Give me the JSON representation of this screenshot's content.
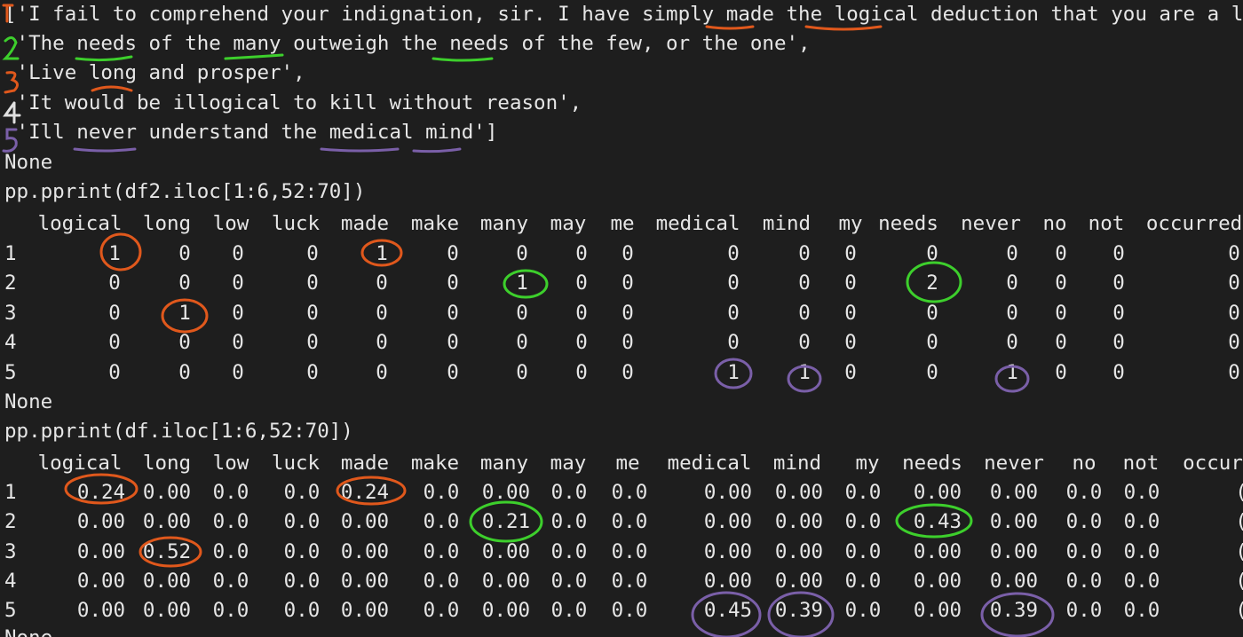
{
  "colors": {
    "background": "#1e1e1e",
    "text": "#e6e6e6",
    "orange": "#e0581c",
    "green": "#3dcf2c",
    "purple": "#7a5fa8"
  },
  "quotes": [
    "['I fail to comprehend your indignation, sir. I have simply made the logical deduction that you are a liar",
    " 'The needs of the many outweigh the needs of the few, or the one',",
    " 'Live long and prosper',",
    " 'It would be illogical to kill without reason',",
    " 'Ill never understand the medical mind']"
  ],
  "margin_numbers": [
    "1",
    "2",
    "3",
    "4",
    "5"
  ],
  "none_1": "None",
  "cmd_1": "pp.pprint(df2.iloc[1:6,52:70])",
  "table1": {
    "headers": [
      "logical",
      "long",
      "low",
      "luck",
      "made",
      "make",
      "many",
      "may",
      "me",
      "medical",
      "mind",
      "my",
      "needs",
      "never",
      "no",
      "not",
      "occurred"
    ],
    "rows": [
      {
        "index": "1",
        "values": [
          "1",
          "0",
          "0",
          "0",
          "1",
          "0",
          "0",
          "0",
          "0",
          "0",
          "0",
          "0",
          "0",
          "0",
          "0",
          "0",
          "0"
        ]
      },
      {
        "index": "2",
        "values": [
          "0",
          "0",
          "0",
          "0",
          "0",
          "0",
          "1",
          "0",
          "0",
          "0",
          "0",
          "0",
          "2",
          "0",
          "0",
          "0",
          "0"
        ]
      },
      {
        "index": "3",
        "values": [
          "0",
          "1",
          "0",
          "0",
          "0",
          "0",
          "0",
          "0",
          "0",
          "0",
          "0",
          "0",
          "0",
          "0",
          "0",
          "0",
          "0"
        ]
      },
      {
        "index": "4",
        "values": [
          "0",
          "0",
          "0",
          "0",
          "0",
          "0",
          "0",
          "0",
          "0",
          "0",
          "0",
          "0",
          "0",
          "0",
          "0",
          "0",
          "0"
        ]
      },
      {
        "index": "5",
        "values": [
          "0",
          "0",
          "0",
          "0",
          "0",
          "0",
          "0",
          "0",
          "0",
          "1",
          "1",
          "0",
          "0",
          "1",
          "0",
          "0",
          "0"
        ]
      }
    ]
  },
  "none_2": "None",
  "cmd_2": "pp.pprint(df.iloc[1:6,52:70])",
  "table2": {
    "headers": [
      "logical",
      "long",
      "low",
      "luck",
      "made",
      "make",
      "many",
      "may",
      "me",
      "medical",
      "mind",
      "my",
      "needs",
      "never",
      "no",
      "not",
      "occur"
    ],
    "rows": [
      {
        "index": "1",
        "values": [
          "0.24",
          "0.00",
          "0.0",
          "0.0",
          "0.24",
          "0.0",
          "0.00",
          "0.0",
          "0.0",
          "0.00",
          "0.00",
          "0.0",
          "0.00",
          "0.00",
          "0.0",
          "0.0",
          "("
        ]
      },
      {
        "index": "2",
        "values": [
          "0.00",
          "0.00",
          "0.0",
          "0.0",
          "0.00",
          "0.0",
          "0.21",
          "0.0",
          "0.0",
          "0.00",
          "0.00",
          "0.0",
          "0.43",
          "0.00",
          "0.0",
          "0.0",
          "("
        ]
      },
      {
        "index": "3",
        "values": [
          "0.00",
          "0.52",
          "0.0",
          "0.0",
          "0.00",
          "0.0",
          "0.00",
          "0.0",
          "0.0",
          "0.00",
          "0.00",
          "0.0",
          "0.00",
          "0.00",
          "0.0",
          "0.0",
          "("
        ]
      },
      {
        "index": "4",
        "values": [
          "0.00",
          "0.00",
          "0.0",
          "0.0",
          "0.00",
          "0.0",
          "0.00",
          "0.0",
          "0.0",
          "0.00",
          "0.00",
          "0.0",
          "0.00",
          "0.00",
          "0.0",
          "0.0",
          "("
        ]
      },
      {
        "index": "5",
        "values": [
          "0.00",
          "0.00",
          "0.0",
          "0.0",
          "0.00",
          "0.0",
          "0.00",
          "0.0",
          "0.0",
          "0.45",
          "0.39",
          "0.0",
          "0.00",
          "0.39",
          "0.0",
          "0.0",
          "("
        ]
      }
    ]
  },
  "truncated_line": "None"
}
